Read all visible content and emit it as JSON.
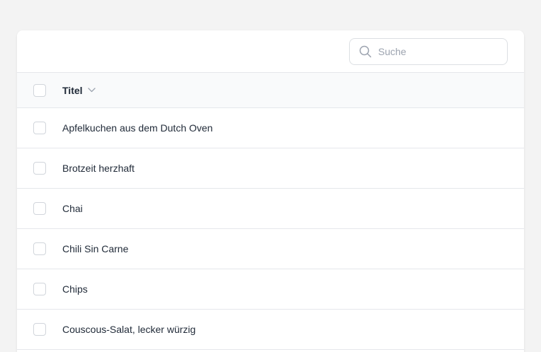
{
  "search": {
    "placeholder": "Suche",
    "icon": "search-icon"
  },
  "table": {
    "columns": [
      {
        "label": "Titel",
        "sort_icon": "chevron-down-icon"
      }
    ],
    "rows": [
      {
        "title": "Apfelkuchen aus dem Dutch Oven"
      },
      {
        "title": "Brotzeit herzhaft"
      },
      {
        "title": "Chai"
      },
      {
        "title": "Chili Sin Carne"
      },
      {
        "title": "Chips"
      },
      {
        "title": "Couscous-Salat, lecker würzig"
      }
    ]
  },
  "colors": {
    "page_background": "#f3f3f3",
    "card_background": "#ffffff",
    "header_background": "#f9fafb",
    "border": "#e5e7eb",
    "text": "#1f2937",
    "placeholder": "#9ca3af"
  }
}
